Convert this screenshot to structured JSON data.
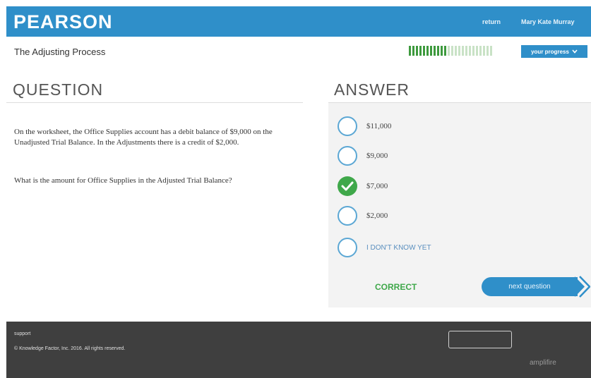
{
  "header": {
    "logo": "PEARSON",
    "return_label": "return",
    "user_name": "Mary Kate Murray"
  },
  "subheader": {
    "title": "The Adjusting Process",
    "progress_label": "your progress",
    "progress": {
      "filled_segments": 11,
      "total_segments": 24
    }
  },
  "question": {
    "heading": "QUESTION",
    "text": "On the worksheet, the Office Supplies account has a debit balance of $9,000 on the Unadjusted Trial Balance. In the Adjustments there is a credit of $2,000.",
    "prompt": "What is the amount for Office Supplies in the Adjusted Trial Balance?"
  },
  "answer": {
    "heading": "ANSWER",
    "options": [
      {
        "label": "$11,000",
        "selected": false
      },
      {
        "label": "$9,000",
        "selected": false
      },
      {
        "label": "$7,000",
        "selected": true
      },
      {
        "label": "$2,000",
        "selected": false
      },
      {
        "label": "I DON'T KNOW YET",
        "selected": false
      }
    ],
    "result": "CORRECT",
    "next_label": "next question"
  },
  "footer": {
    "support_label": "support",
    "copyright": "© Knowledge Factor, Inc. 2016. All rights reserved.",
    "brand": "amplifire"
  },
  "colors": {
    "accent": "#2f8fc9",
    "correct": "#3fa84a",
    "progress_filled": "#3e9a3e",
    "progress_empty": "#c9e2c6"
  }
}
